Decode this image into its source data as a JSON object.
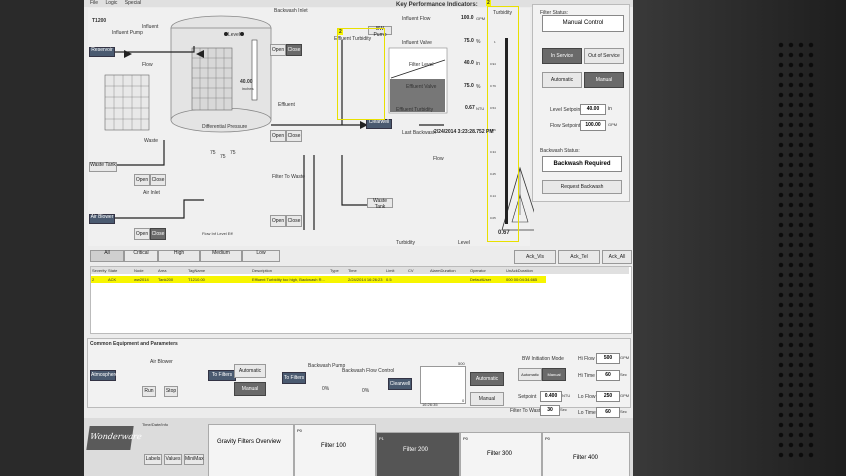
{
  "menu": [
    "File",
    "Logic",
    "Special"
  ],
  "tank": {
    "id": "T1200",
    "influent_pump": "Influent Pump",
    "influent": "Influent",
    "flow": "Flow",
    "level_label": "Level",
    "level_value": "40.00",
    "level_unit": "inches",
    "diff_pressure": "Differential Pressure",
    "waste": "Waste",
    "waste_tank": "Waste Tank",
    "air_inlet": "Air Inlet",
    "air_blower": "Air Blower",
    "reservoir": "Reservoir",
    "clearwell": "Clearwell",
    "backwash_inlet": "Backwash Inlet",
    "effluent": "Effluent",
    "filter_to_waste": "Filter To Waste",
    "effluent_turbidity": "Effluent Turbidity",
    "bw_pump": "BW Pump",
    "open": "Open",
    "close": "Close",
    "dp_values": [
      "75",
      "75",
      "75"
    ],
    "dp_labels": "Flow  Inf  Level  Eff"
  },
  "kpi": {
    "title": "Key Performance Indicators:",
    "items": [
      {
        "label": "Influent Flow",
        "value": "100.0",
        "unit": "GPM"
      },
      {
        "label": "Influent Valve",
        "value": "75.0",
        "unit": "%"
      },
      {
        "label": "Filter Level",
        "value": "40.0",
        "unit": "in"
      },
      {
        "label": "Effluent Valve",
        "value": "75.0",
        "unit": "%"
      },
      {
        "label": "Effluent Turbidity",
        "value": "0.67",
        "unit": "NTU"
      }
    ],
    "last_backwash_label": "Last Backwash",
    "last_backwash_value": "2/24/2014 3:23:28.752 PM",
    "radar_labels": [
      "Flow",
      "Turbidity",
      "Level"
    ],
    "turbidity_title": "Turbidity",
    "turbidity_value": "0.67",
    "turbidity_ticks": [
      "1",
      "0.94",
      "0.79",
      "0.54",
      "0.45",
      "0.34",
      "0.25",
      "0.14",
      "0.05"
    ],
    "marker": "2"
  },
  "status": {
    "filter_status_label": "Filter Status:",
    "filter_status": "Manual Control",
    "in_service": "In Service",
    "out_of_service": "Out of Service",
    "automatic": "Automatic",
    "manual": "Manual",
    "level_setpoint_label": "Level Setpoint",
    "level_setpoint": "40.00",
    "level_unit": "in",
    "flow_setpoint_label": "Flow Setpoint",
    "flow_setpoint": "100.00",
    "flow_unit": "GPM",
    "backwash_status_label": "Backwash Status:",
    "backwash_status": "Backwash Required",
    "request_backwash": "Request Backwash"
  },
  "alarms": {
    "filters": [
      "All",
      "Critical",
      "High",
      "Medium",
      "Low"
    ],
    "ack": [
      "Ack_Vis",
      "Ack_Tel",
      "Ack_All"
    ],
    "columns": [
      "Severity",
      "State",
      "Node",
      "Area",
      "TagName",
      "Description",
      "Type",
      "Time",
      "Limit",
      "CV",
      "AlarmDuration",
      "Operator",
      "UnAckDuration"
    ],
    "row": [
      "2",
      "ACK",
      "ww2014",
      "Tank200",
      "T1210.00",
      "Effluent Turbidity too high, Backwash R...",
      "",
      "2/24/2014 16:26:23",
      "0.5",
      "",
      "",
      "DefaultUser",
      "000 00:04:34.665"
    ]
  },
  "common": {
    "title": "Common Equipment and Parameters",
    "air_blower": "Air Blower",
    "atmosphere": "Atmosphere",
    "to_filters": "To Filters",
    "run": "Run",
    "stop": "Stop",
    "automatic": "Automatic",
    "manual": "Manual",
    "backwash_pump": "Backwash Pump",
    "backwash_flow_control": "Backwash Flow Control",
    "clearwell": "Clearwell",
    "pct1": "0%",
    "pct2": "0%",
    "trend_top": "500",
    "trend_bottom": "0",
    "trend_time": "16:26:35",
    "bw_mode_label": "BW Initiation Mode",
    "setpoint_label": "Setpoint",
    "setpoint": "0.400",
    "setpoint_unit": "NTU",
    "filter_to_waste_label": "Filter To Waste",
    "filter_to_waste": "30",
    "filter_to_waste_unit": "Sec",
    "hi_flow_label": "Hi Flow",
    "hi_flow": "500",
    "hi_flow_unit": "GPM",
    "hi_time_label": "Hi Time",
    "hi_time": "60",
    "hi_time_unit": "Sec",
    "lo_flow_label": "Lo Flow",
    "lo_flow": "250",
    "lo_flow_unit": "GPM",
    "lo_time_label": "Lo Time",
    "lo_time": "60",
    "lo_time_unit": "Sec"
  },
  "nav": {
    "logo": "Wonderware",
    "clock_label": "Time/Date/Info",
    "tabs": [
      "Labels",
      "Values",
      "MiniMax"
    ],
    "tiles": [
      {
        "label": "Gravity Filters Overview",
        "num": ""
      },
      {
        "label": "Filter 100",
        "num": "P0"
      },
      {
        "label": "Filter 200",
        "num": "P1"
      },
      {
        "label": "Filter 300",
        "num": "P0"
      },
      {
        "label": "Filter 400",
        "num": "P0"
      }
    ]
  },
  "colors": {
    "yellow": "#f7f500",
    "bezel": "#2a2a2a",
    "screen": "#ececec"
  }
}
